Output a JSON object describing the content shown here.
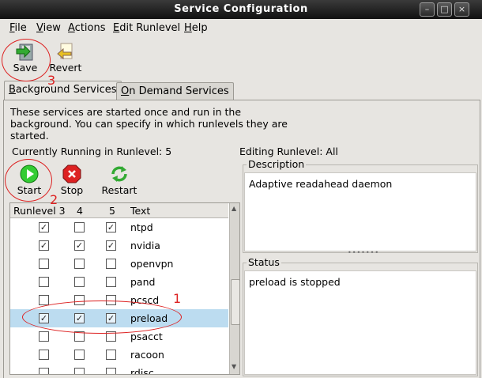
{
  "window": {
    "title": "Service Configuration"
  },
  "menu": [
    {
      "mn": "F",
      "rest": "ile"
    },
    {
      "mn": "V",
      "rest": "iew"
    },
    {
      "mn": "A",
      "rest": "ctions"
    },
    {
      "mn": "E",
      "rest": "dit Runlevel"
    },
    {
      "mn": "H",
      "rest": "elp"
    }
  ],
  "toolbar": {
    "save_label": "Save",
    "revert_label": "Revert"
  },
  "tabs": [
    {
      "label": "Background Services",
      "underline_index": 0,
      "active": true
    },
    {
      "label": "On Demand Services",
      "underline_index": 0,
      "active": false
    }
  ],
  "description_text": "These services are started once and run in the background. You can specify in which runlevels they are started.",
  "current_runlevel_label": "Currently Running in Runlevel: 5",
  "editing_runlevel_label": "Editing Runlevel: All",
  "service_toolbar": {
    "start_label": "Start",
    "stop_label": "Stop",
    "restart_label": "Restart"
  },
  "columns": [
    "Runlevel 3",
    "4",
    "5",
    "Text"
  ],
  "services": [
    {
      "name": "ntpd",
      "rl3": true,
      "rl4": false,
      "rl5": true,
      "selected": false
    },
    {
      "name": "nvidia",
      "rl3": true,
      "rl4": true,
      "rl5": true,
      "selected": false
    },
    {
      "name": "openvpn",
      "rl3": false,
      "rl4": false,
      "rl5": false,
      "selected": false
    },
    {
      "name": "pand",
      "rl3": false,
      "rl4": false,
      "rl5": false,
      "selected": false
    },
    {
      "name": "pcscd",
      "rl3": false,
      "rl4": false,
      "rl5": false,
      "selected": false
    },
    {
      "name": "preload",
      "rl3": true,
      "rl4": true,
      "rl5": true,
      "selected": true
    },
    {
      "name": "psacct",
      "rl3": false,
      "rl4": false,
      "rl5": false,
      "selected": false
    },
    {
      "name": "racoon",
      "rl3": false,
      "rl4": false,
      "rl5": false,
      "selected": false
    },
    {
      "name": "rdisc",
      "rl3": false,
      "rl4": false,
      "rl5": false,
      "selected": false
    }
  ],
  "description_frame": {
    "label": "Description",
    "value": "Adaptive readahead daemon"
  },
  "status_frame": {
    "label": "Status",
    "value": "preload is stopped"
  },
  "annotations": {
    "one": "1",
    "two": "2",
    "three": "3"
  },
  "colors": {
    "selection": "#bcdcf0",
    "annotation": "#dd2222",
    "title_bar": "#1a1a1a"
  }
}
